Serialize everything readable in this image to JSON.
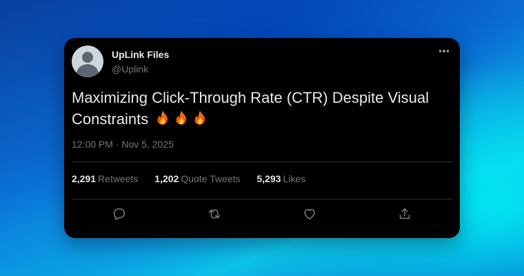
{
  "author": {
    "name": "UpLink Files",
    "handle": "@Uplink"
  },
  "tweet": {
    "text": "Maximizing Click-Through Rate (CTR) Despite Visual Constraints",
    "emoji": "fire",
    "emoji_count": 3,
    "timestamp": "12:00 PM · Nov 5, 2025"
  },
  "stats": {
    "retweets": {
      "count": "2,291",
      "label": "Retweets"
    },
    "quote_tweets": {
      "count": "1,202",
      "label": "Quote Tweets"
    },
    "likes": {
      "count": "5,293",
      "label": "Likes"
    }
  },
  "actions": [
    {
      "icon": "reply-icon"
    },
    {
      "icon": "retweet-icon"
    },
    {
      "icon": "like-icon"
    },
    {
      "icon": "share-icon"
    }
  ],
  "colors": {
    "card_background": "#000000",
    "primary_text": "#e7e9ea",
    "secondary_text": "#71767b",
    "divider": "#2f3336"
  }
}
